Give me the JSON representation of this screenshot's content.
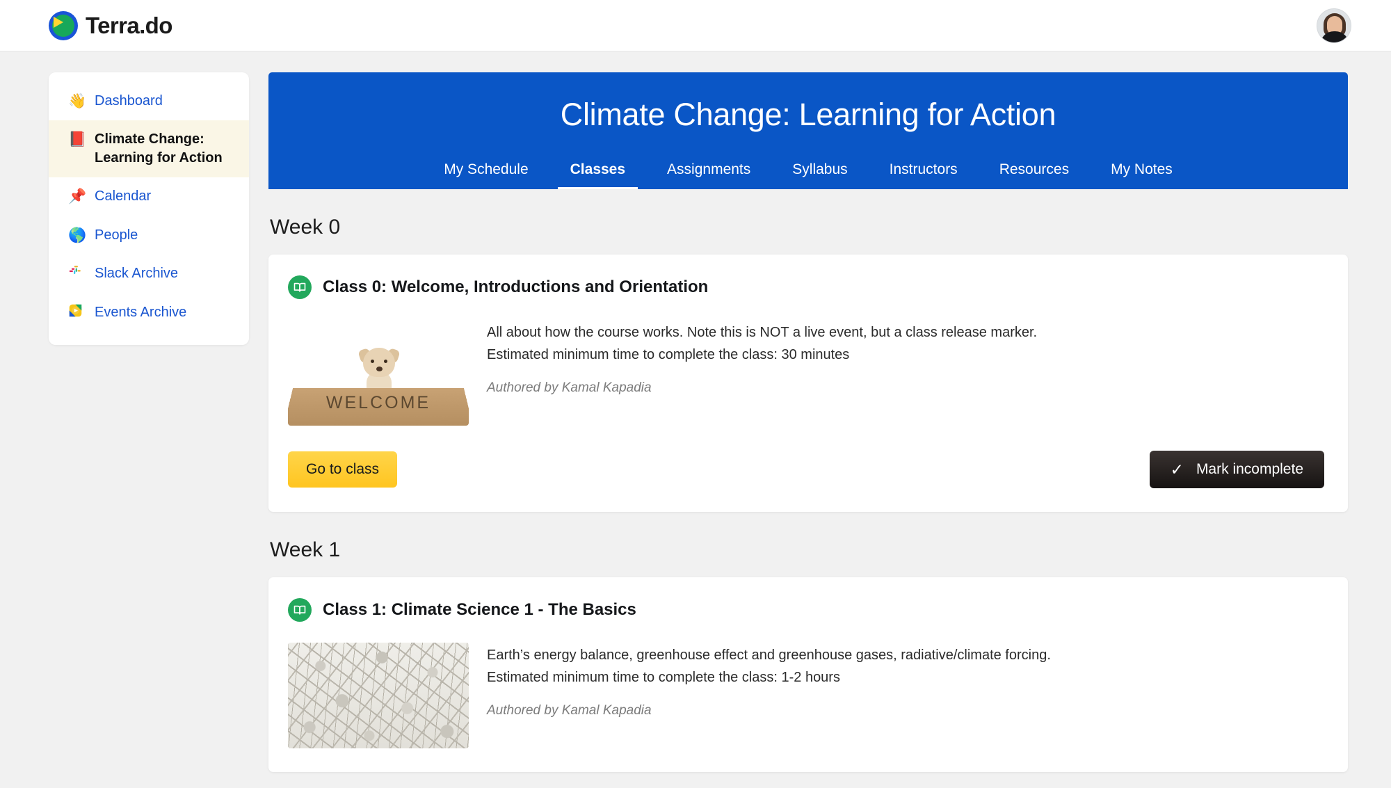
{
  "brand": {
    "name": "Terra.do",
    "logo_icon": "terra-play-globe-icon",
    "colors": {
      "ring": "#1a54d8",
      "disc": "#17a85a",
      "play": "#ffd633"
    }
  },
  "topbar": {
    "avatar_icon": "user-avatar"
  },
  "sidebar": {
    "items": [
      {
        "emoji": "👋",
        "icon": "waving-hand-icon",
        "label": "Dashboard",
        "name": "sidebar-item-dashboard",
        "active": false
      },
      {
        "emoji": "📕",
        "icon": "closed-book-icon",
        "label": "Climate Change:\nLearning for Action",
        "name": "sidebar-item-climate-change",
        "active": true
      },
      {
        "emoji": "📌",
        "icon": "pushpin-icon",
        "label": "Calendar",
        "name": "sidebar-item-calendar",
        "active": false
      },
      {
        "emoji": "🌎",
        "icon": "globe-icon",
        "label": "People",
        "name": "sidebar-item-people",
        "active": false
      },
      {
        "emoji": "✤",
        "icon": "slack-icon",
        "label": "Slack Archive",
        "name": "sidebar-item-slack-archive",
        "active": false
      },
      {
        "emoji": "▶",
        "icon": "events-play-icon",
        "label": "Events Archive",
        "name": "sidebar-item-events-archive",
        "active": false
      }
    ]
  },
  "banner": {
    "title": "Climate Change: Learning for Action",
    "background": "#0a56c6",
    "tabs": [
      {
        "label": "My Schedule",
        "active": false
      },
      {
        "label": "Classes",
        "active": true
      },
      {
        "label": "Assignments",
        "active": false
      },
      {
        "label": "Syllabus",
        "active": false
      },
      {
        "label": "Instructors",
        "active": false
      },
      {
        "label": "Resources",
        "active": false
      },
      {
        "label": "My Notes",
        "active": false
      }
    ]
  },
  "weeks": [
    {
      "title": "Week 0",
      "card": {
        "badge_icon": "open-book-icon",
        "title": "Class 0: Welcome, Introductions and Orientation",
        "thumbnail": "puppy-on-welcome-mat",
        "thumbnail_text": "WELCOME",
        "description_line1": "All about how the course works. Note this is NOT a live event, but a class release marker.",
        "description_line2": "Estimated minimum time to complete the class: 30 minutes",
        "authored": "Authored by Kamal Kapadia",
        "primary_button": "Go to class",
        "secondary_button": "Mark incomplete",
        "secondary_button_icon": "checkmark-icon"
      }
    },
    {
      "title": "Week 1",
      "card": {
        "badge_icon": "open-book-icon",
        "title": "Class 1: Climate Science 1 - The Basics",
        "thumbnail": "cracked-dry-earth",
        "description_line1": "Earth’s energy balance, greenhouse effect and greenhouse gases, radiative/climate forcing.",
        "description_line2": "Estimated minimum time to complete the class: 1-2 hours",
        "authored": "Authored by Kamal Kapadia"
      }
    }
  ]
}
